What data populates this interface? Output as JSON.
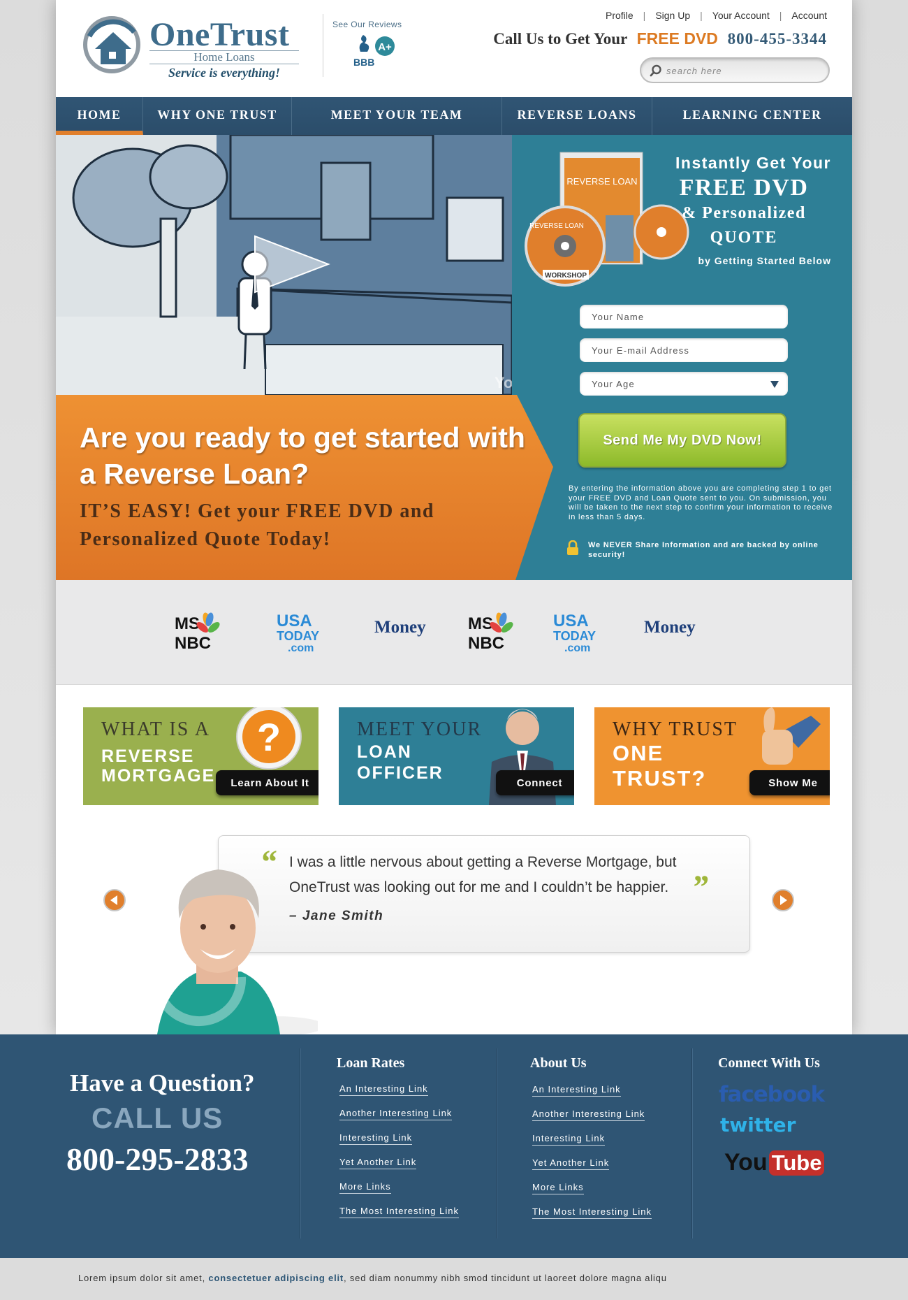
{
  "brand": {
    "name": "OneTrust",
    "subtitle": "Home Loans",
    "tagline": "Service is everything!",
    "reviews_label": "See Our Reviews",
    "bbb_rating": "A+",
    "bbb_text": "BBB"
  },
  "top_links": [
    "Profile",
    "Sign Up",
    "Your Account",
    "Account"
  ],
  "call_line": {
    "prefix": "Call Us to Get Your",
    "highlight": "FREE DVD",
    "phone": "800-455-3344"
  },
  "search": {
    "placeholder": "search here"
  },
  "nav": [
    "HOME",
    "WHY ONE TRUST",
    "MEET YOUR TEAM",
    "REVERSE LOANS",
    "LEARNING CENTER"
  ],
  "video": {
    "watermark": "Yo"
  },
  "hero": {
    "headline": "Are you ready to get started with a Reverse Loan?",
    "subheadline": "IT’S EASY! Get your FREE DVD and Personalized Quote Today!"
  },
  "signup": {
    "line1": "Instantly Get Your",
    "line2": "FREE DVD",
    "line3": "& Personalized",
    "line4": "QUOTE",
    "line5": "by Getting Started Below",
    "dvd_case_title": "REVERSE LOAN",
    "dvd_disc_title": "REVERSE LOAN",
    "dvd_disc_sub": "WORKSHOP",
    "name_placeholder": "Your Name",
    "email_placeholder": "Your E-mail Address",
    "age_placeholder": "Your Age",
    "submit_label": "Send Me My DVD Now!",
    "disclaimer": "By entering the information above you are completing step 1 to get your FREE DVD  and Loan Quote sent to you. On submission, you will be taken to  the next step to confirm your information to receive in less than 5 days.",
    "security": "We NEVER  Share Information and are backed by online security!"
  },
  "media": {
    "msnbc_top": "MS",
    "msnbc_bottom": "NBC",
    "usa_top": "USA",
    "usa_mid": "TODAY",
    "usa_bottom": ".com",
    "money": "Money"
  },
  "boxes": [
    {
      "line1": "WHAT IS A",
      "line2": "REVERSE",
      "line3": "MORTGAGE",
      "button": "Learn About It",
      "color": "#9ab04e"
    },
    {
      "line1": "MEET YOUR",
      "line2": "LOAN",
      "line3": "OFFICER",
      "button": "Connect",
      "color": "#2e7f96"
    },
    {
      "line1": "WHY TRUST",
      "line2": "ONE",
      "line3": "TRUST?",
      "button": "Show Me",
      "color": "#ef9330"
    }
  ],
  "testimonial": {
    "open_mark": "“",
    "close_mark": "”",
    "quote": "I was a little nervous about getting a Reverse Mortgage, but OneTrust was looking out for me and I couldn’t be happier.",
    "author": "– Jane Smith"
  },
  "footer": {
    "question": "Have a Question?",
    "call_us": "CALL US",
    "phone": "800-295-2833",
    "col1_title": "Loan Rates",
    "col2_title": "About Us",
    "col3_title": "Connect With Us",
    "links": [
      "An Interesting Link",
      "Another Interesting Link",
      "Interesting Link",
      "Yet Another Link",
      "More Links",
      "The Most Interesting Link"
    ],
    "social": {
      "facebook": "facebook",
      "twitter": "twitter",
      "you": "You",
      "tube": "Tube"
    }
  },
  "bottom_bar": {
    "text_a": "Lorem ipsum dolor sit amet,",
    "text_b": "consectetuer adipiscing elit",
    "text_c": ", sed diam nonummy nibh smod tincidunt ut laoreet dolore magna aliqu"
  },
  "colors": {
    "nav_blue": "#305574",
    "accent_orange": "#e07f2c",
    "panel_teal": "#2e7f96",
    "cta_green": "#9ac53a",
    "footer_blue": "#2f5574"
  }
}
